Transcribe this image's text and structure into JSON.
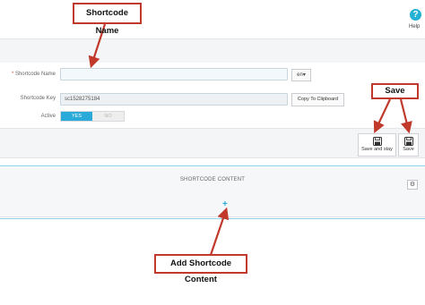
{
  "help": {
    "icon": "question-icon",
    "label": "Help"
  },
  "form": {
    "shortcode_name": {
      "required_mark": "*",
      "label": "Shortcode Name",
      "value": "",
      "language": "en"
    },
    "shortcode_key": {
      "label": "Shortcode Key",
      "value": "sc1528275184",
      "copy_button": "Copy To Clipboard"
    },
    "active": {
      "label": "Active",
      "yes": "YES",
      "no": "NO",
      "selected": "YES"
    }
  },
  "toolbar": {
    "save_and_stay": {
      "label": "Save and stay",
      "icon": "floppy-disk-icon"
    },
    "save": {
      "label": "Save",
      "icon": "floppy-disk-icon"
    }
  },
  "content_section": {
    "title": "SHORTCODE CONTENT",
    "settings_icon": "gear-icon",
    "add_icon": "plus-icon",
    "add_symbol": "+"
  },
  "annotations": {
    "shortcode_name": "Shortcode Name",
    "save": "Save",
    "add_content": "Add Shortcode Content"
  },
  "colors": {
    "accent": "#2aaad8",
    "callout_border": "#c0392b",
    "required": "#e74c3c"
  }
}
